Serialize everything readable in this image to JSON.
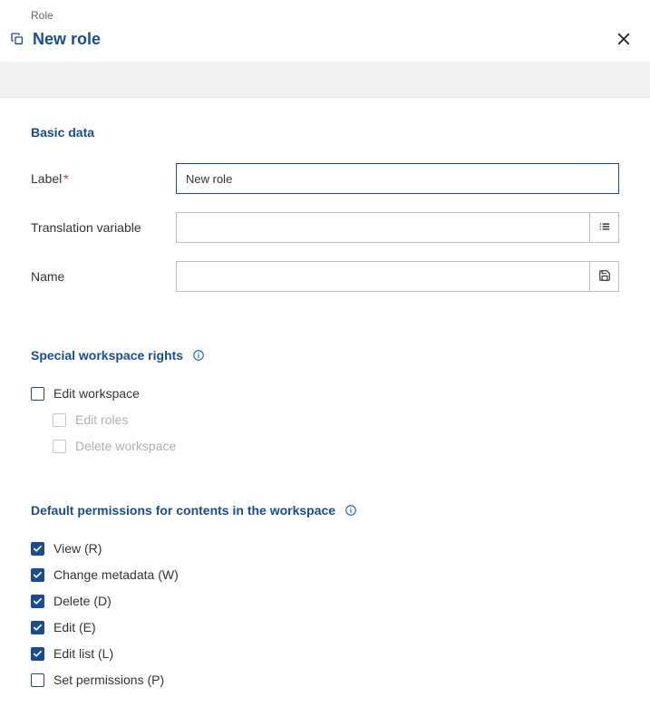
{
  "breadcrumb": "Role",
  "page_title": "New role",
  "sections": {
    "basic_data": {
      "heading": "Basic data",
      "fields": {
        "label": {
          "label": "Label",
          "required": true,
          "value": "New role"
        },
        "translation_variable": {
          "label": "Translation variable",
          "value": ""
        },
        "name": {
          "label": "Name",
          "value": ""
        }
      }
    },
    "special_workspace_rights": {
      "heading": "Special workspace rights",
      "items": [
        {
          "label": "Edit workspace",
          "checked": false,
          "disabled": false,
          "indent": 0
        },
        {
          "label": "Edit roles",
          "checked": false,
          "disabled": true,
          "indent": 1
        },
        {
          "label": "Delete workspace",
          "checked": false,
          "disabled": true,
          "indent": 1
        }
      ]
    },
    "default_permissions": {
      "heading": "Default permissions for contents in the workspace",
      "items": [
        {
          "label": "View (R)",
          "checked": true
        },
        {
          "label": "Change metadata (W)",
          "checked": true
        },
        {
          "label": "Delete (D)",
          "checked": true
        },
        {
          "label": "Edit (E)",
          "checked": true
        },
        {
          "label": "Edit list (L)",
          "checked": true
        },
        {
          "label": "Set permissions (P)",
          "checked": false
        }
      ]
    }
  }
}
